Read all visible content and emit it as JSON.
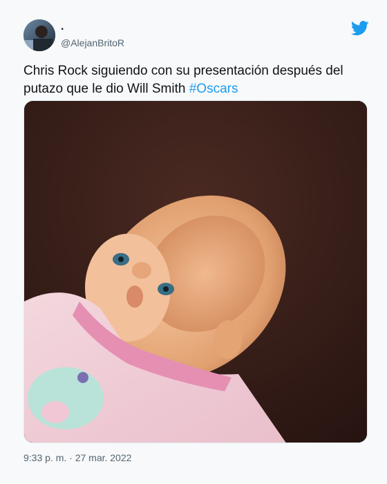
{
  "author": {
    "display_name": ".",
    "handle": "@AlejanBritoR",
    "avatar_icon": "user-avatar"
  },
  "tweet": {
    "text_main": "Chris Rock siguiendo con su presentación después del putazo que le dio Will Smith ",
    "hashtag": "#Oscars",
    "timestamp": "9:33 p. m. · 27 mar. 2022"
  },
  "icons": {
    "brand": "twitter-bird-icon"
  },
  "colors": {
    "accent": "#1d9bf0",
    "background": "#f7f9fa",
    "secondary_text": "#536471"
  }
}
